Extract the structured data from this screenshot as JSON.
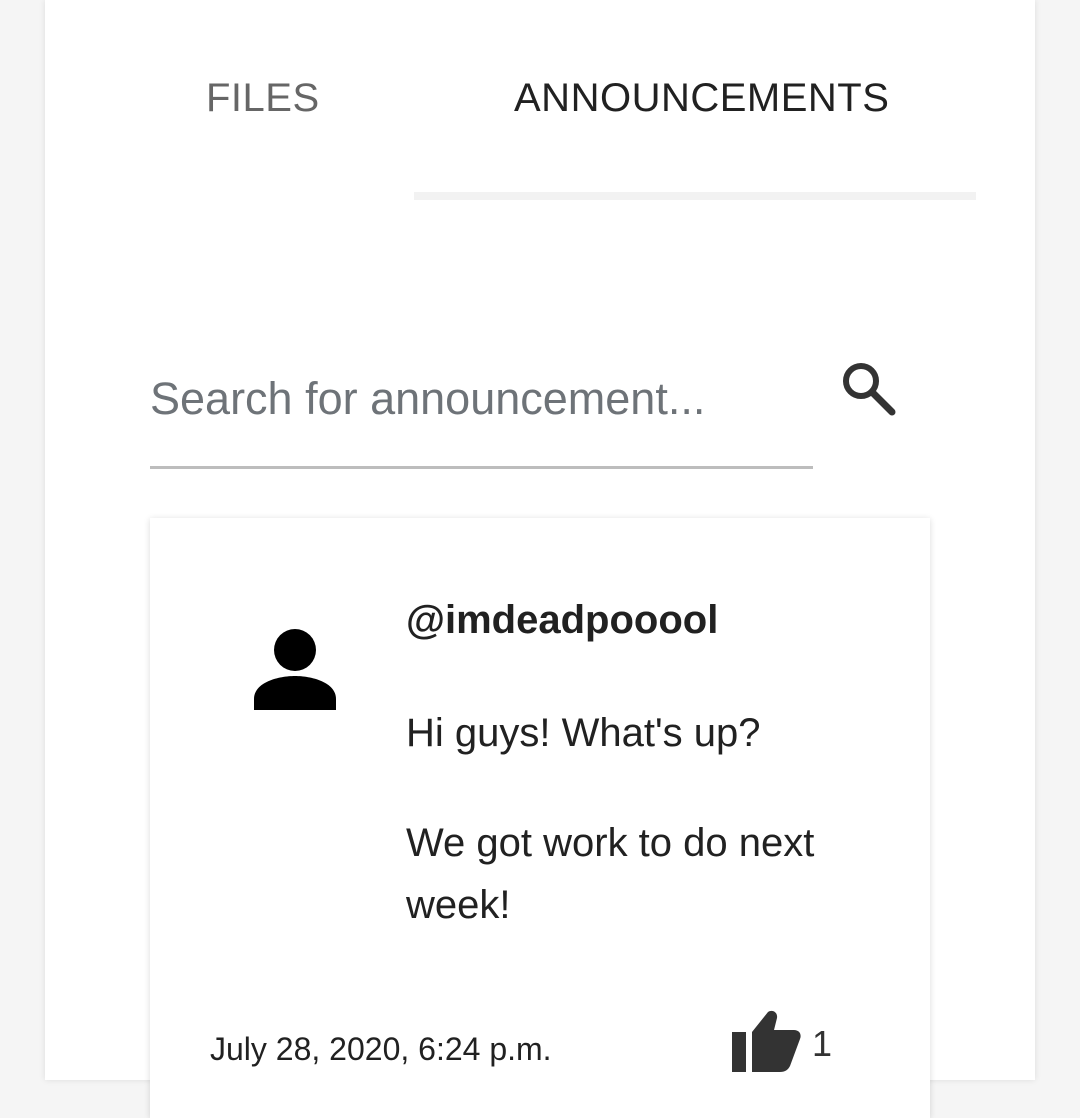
{
  "tabs": {
    "files": "FILES",
    "announcements": "ANNOUNCEMENTS",
    "active": "ANNOUNCEMENTS"
  },
  "search": {
    "placeholder": "Search for announcement...",
    "value": "",
    "icon": "search-icon"
  },
  "announcement": {
    "avatar_icon": "person-icon",
    "username": "@imdeadpooool",
    "message_lines": [
      "Hi guys! What's up?",
      "We got work to do next week!"
    ],
    "timestamp": "July 28, 2020, 6:24 p.m.",
    "like_icon": "thumbs-up-icon",
    "like_count": "1"
  }
}
